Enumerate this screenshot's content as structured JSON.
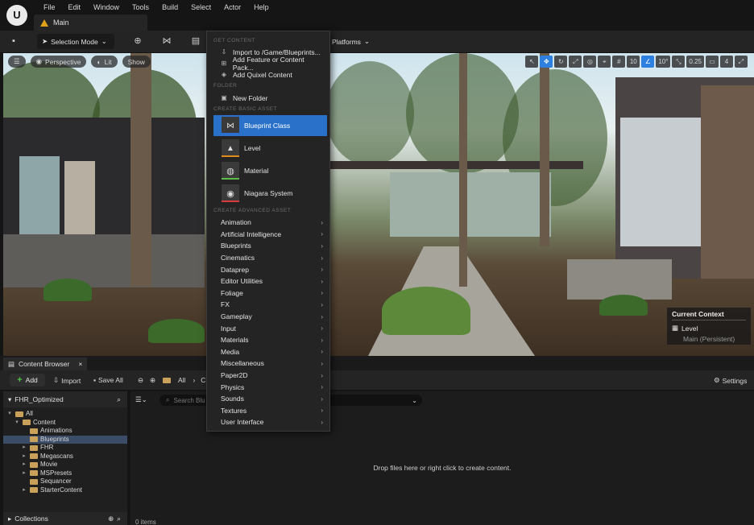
{
  "menubar": {
    "items": [
      "File",
      "Edit",
      "Window",
      "Tools",
      "Build",
      "Select",
      "Actor",
      "Help"
    ],
    "tab_label": "Main"
  },
  "toolbar": {
    "selection_mode": "Selection Mode",
    "platforms": "Platforms"
  },
  "viewport": {
    "perspective": "Perspective",
    "lit": "Lit",
    "show": "Show",
    "grid_snap": "10",
    "rotation_snap": "10°",
    "scale_snap": "0.25",
    "camera_speed": "4",
    "context_title": "Current Context",
    "context_level": "Level",
    "context_level_sub": "Main (Persistent)"
  },
  "context_menu": {
    "sections": {
      "get_content": "GET CONTENT",
      "folder": "FOLDER",
      "basic": "CREATE BASIC ASSET",
      "advanced": "CREATE ADVANCED ASSET"
    },
    "get_content_items": [
      "Import to /Game/Blueprints...",
      "Add Feature or Content Pack...",
      "Add Quixel Content"
    ],
    "folder_items": [
      "New Folder"
    ],
    "basic_items": [
      {
        "label": "Blueprint Class",
        "color": "#2e6fd6"
      },
      {
        "label": "Level",
        "color": "#e28a1a"
      },
      {
        "label": "Material",
        "color": "#5bbd48"
      },
      {
        "label": "Niagara System",
        "color": "#d63a3a"
      }
    ],
    "advanced_items": [
      "Animation",
      "Artificial Intelligence",
      "Blueprints",
      "Cinematics",
      "Dataprep",
      "Editor Utilities",
      "Foliage",
      "FX",
      "Gameplay",
      "Input",
      "Materials",
      "Media",
      "Miscellaneous",
      "Paper2D",
      "Physics",
      "Sounds",
      "Textures",
      "User Interface"
    ]
  },
  "content_browser": {
    "tab_label": "Content Browser",
    "add": "Add",
    "import": "Import",
    "save_all": "Save All",
    "path_all": "All",
    "path_c": "C",
    "settings": "Settings",
    "project": "FHR_Optimized",
    "search_placeholder": "Search Blu",
    "tree": [
      {
        "label": "All",
        "depth": 0,
        "caret": "▾"
      },
      {
        "label": "Content",
        "depth": 1,
        "caret": "▾"
      },
      {
        "label": "Animations",
        "depth": 2,
        "caret": ""
      },
      {
        "label": "Blueprints",
        "depth": 2,
        "caret": "",
        "selected": true
      },
      {
        "label": "FHR",
        "depth": 2,
        "caret": "▸"
      },
      {
        "label": "Megascans",
        "depth": 2,
        "caret": "▸"
      },
      {
        "label": "Movie",
        "depth": 2,
        "caret": "▸"
      },
      {
        "label": "MSPresets",
        "depth": 2,
        "caret": "▸"
      },
      {
        "label": "Sequancer",
        "depth": 2,
        "caret": ""
      },
      {
        "label": "StarterContent",
        "depth": 2,
        "caret": "▸"
      }
    ],
    "collections": "Collections",
    "drop_text": "Drop files here or right click to create content.",
    "item_count": "0 items"
  }
}
